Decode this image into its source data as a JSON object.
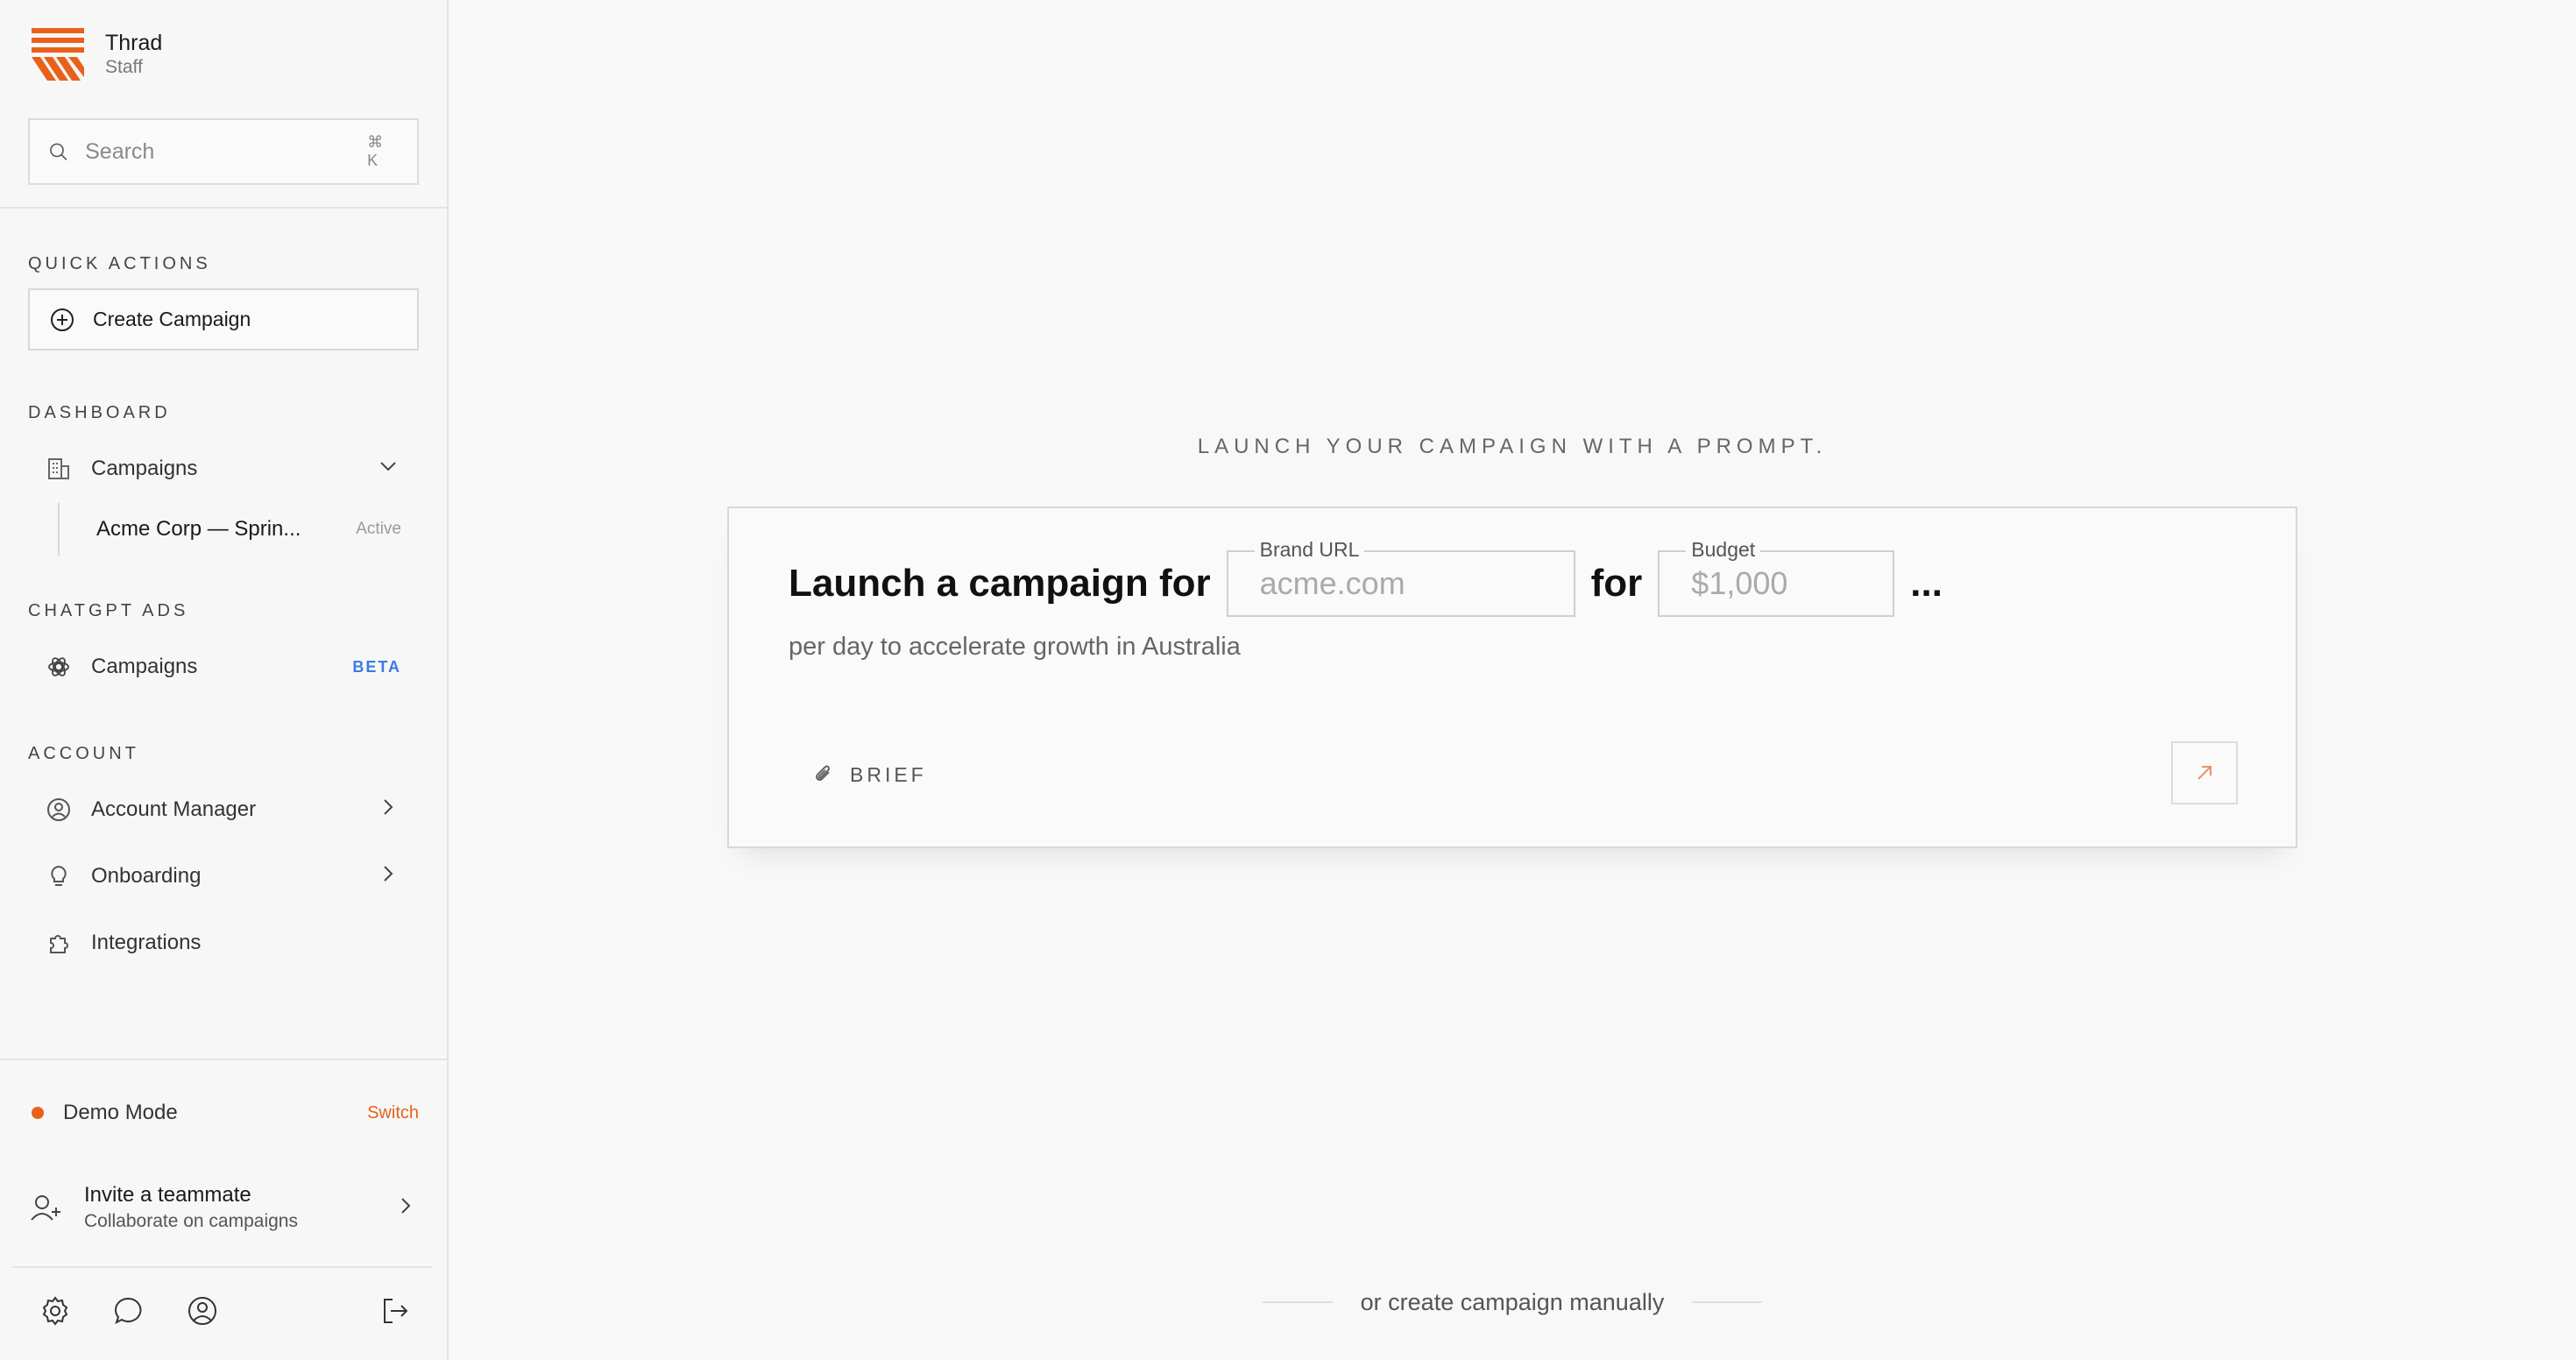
{
  "brand": {
    "name": "Thrad",
    "role": "Staff",
    "color": "#e8611a"
  },
  "search": {
    "placeholder": "Search",
    "shortcut": "⌘ K"
  },
  "sections": {
    "quick_actions": "QUICK ACTIONS",
    "dashboard": "DASHBOARD",
    "chatgpt_ads": "CHATGPT ADS",
    "account": "ACCOUNT"
  },
  "quick_actions": {
    "create_campaign": "Create Campaign"
  },
  "dashboard": {
    "campaigns": "Campaigns",
    "sub_item": {
      "label": "Acme Corp — Sprin...",
      "status": "Active"
    }
  },
  "chatgpt_ads": {
    "campaigns": "Campaigns",
    "badge": "BETA",
    "badge_color": "#3b7be0"
  },
  "account": {
    "account_manager": "Account Manager",
    "onboarding": "Onboarding",
    "integrations": "Integrations"
  },
  "demo": {
    "label": "Demo Mode",
    "action": "Switch"
  },
  "invite": {
    "title": "Invite a teammate",
    "subtitle": "Collaborate on campaigns"
  },
  "footer_icons": [
    "gear-icon",
    "chat-icon",
    "user-circle-icon",
    "logout-icon"
  ],
  "main": {
    "prompt_label": "LAUNCH YOUR CAMPAIGN WITH A PROMPT.",
    "headline_prefix": "Launch a campaign for",
    "brand_url": {
      "legend": "Brand URL",
      "placeholder": "acme.com"
    },
    "connector": "for",
    "budget": {
      "legend": "Budget",
      "placeholder": "$1,000"
    },
    "ellipsis": "...",
    "sub_line": "per day to accelerate growth in Australia",
    "brief_label": "BRIEF",
    "manual_link": "or create campaign manually"
  }
}
